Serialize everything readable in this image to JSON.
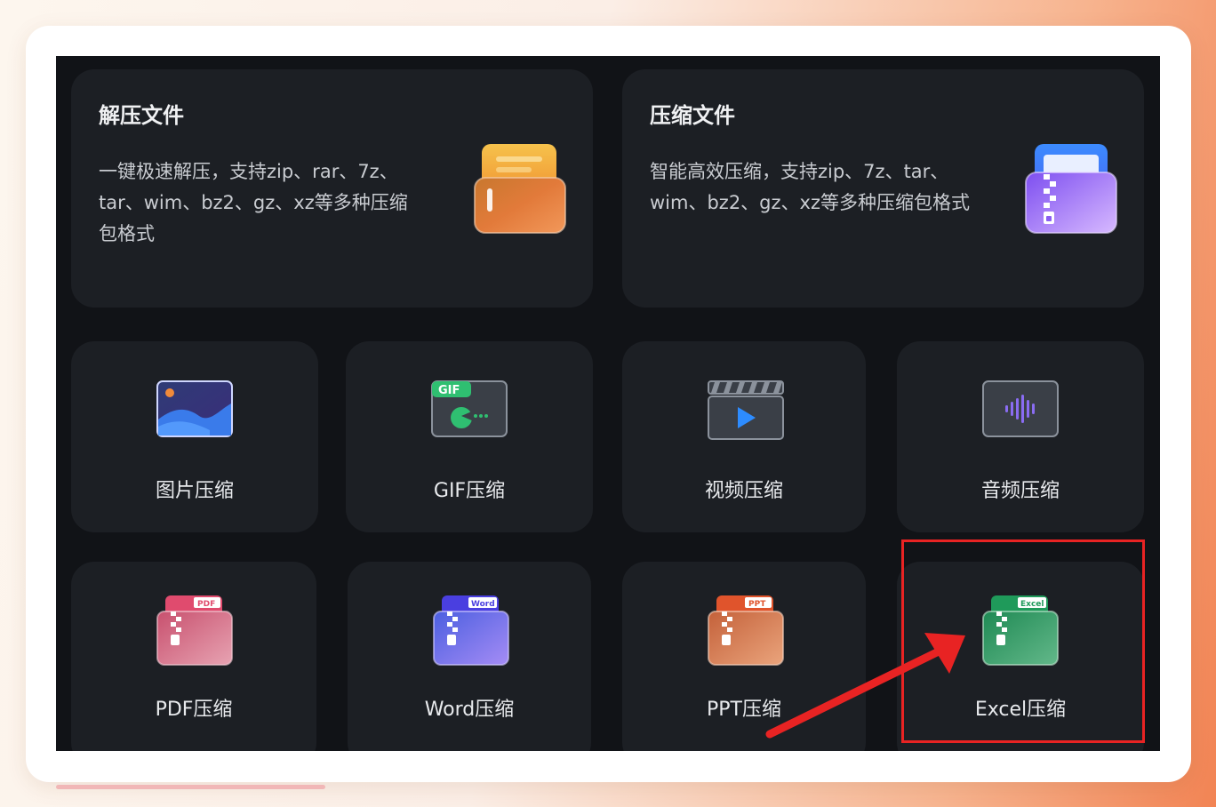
{
  "cards": {
    "decompress": {
      "title": "解压文件",
      "description": "一键极速解压，支持zip、rar、7z、tar、wim、bz2、gz、xz等多种压缩包格式"
    },
    "compress": {
      "title": "压缩文件",
      "description": "智能高效压缩，支持zip、7z、tar、wim、bz2、gz、xz等多种压缩包格式"
    }
  },
  "tools": {
    "image": "图片压缩",
    "gif": "GIF压缩",
    "video": "视频压缩",
    "audio": "音频压缩",
    "pdf": "PDF压缩",
    "word": "Word压缩",
    "ppt": "PPT压缩",
    "excel": "Excel压缩"
  },
  "badges": {
    "gif": "GIF",
    "pdf": "PDF",
    "word": "Word",
    "ppt": "PPT",
    "excel": "Excel"
  },
  "colors": {
    "highlight": "#e82323",
    "background": "#111317",
    "card": "#1c1f24"
  }
}
